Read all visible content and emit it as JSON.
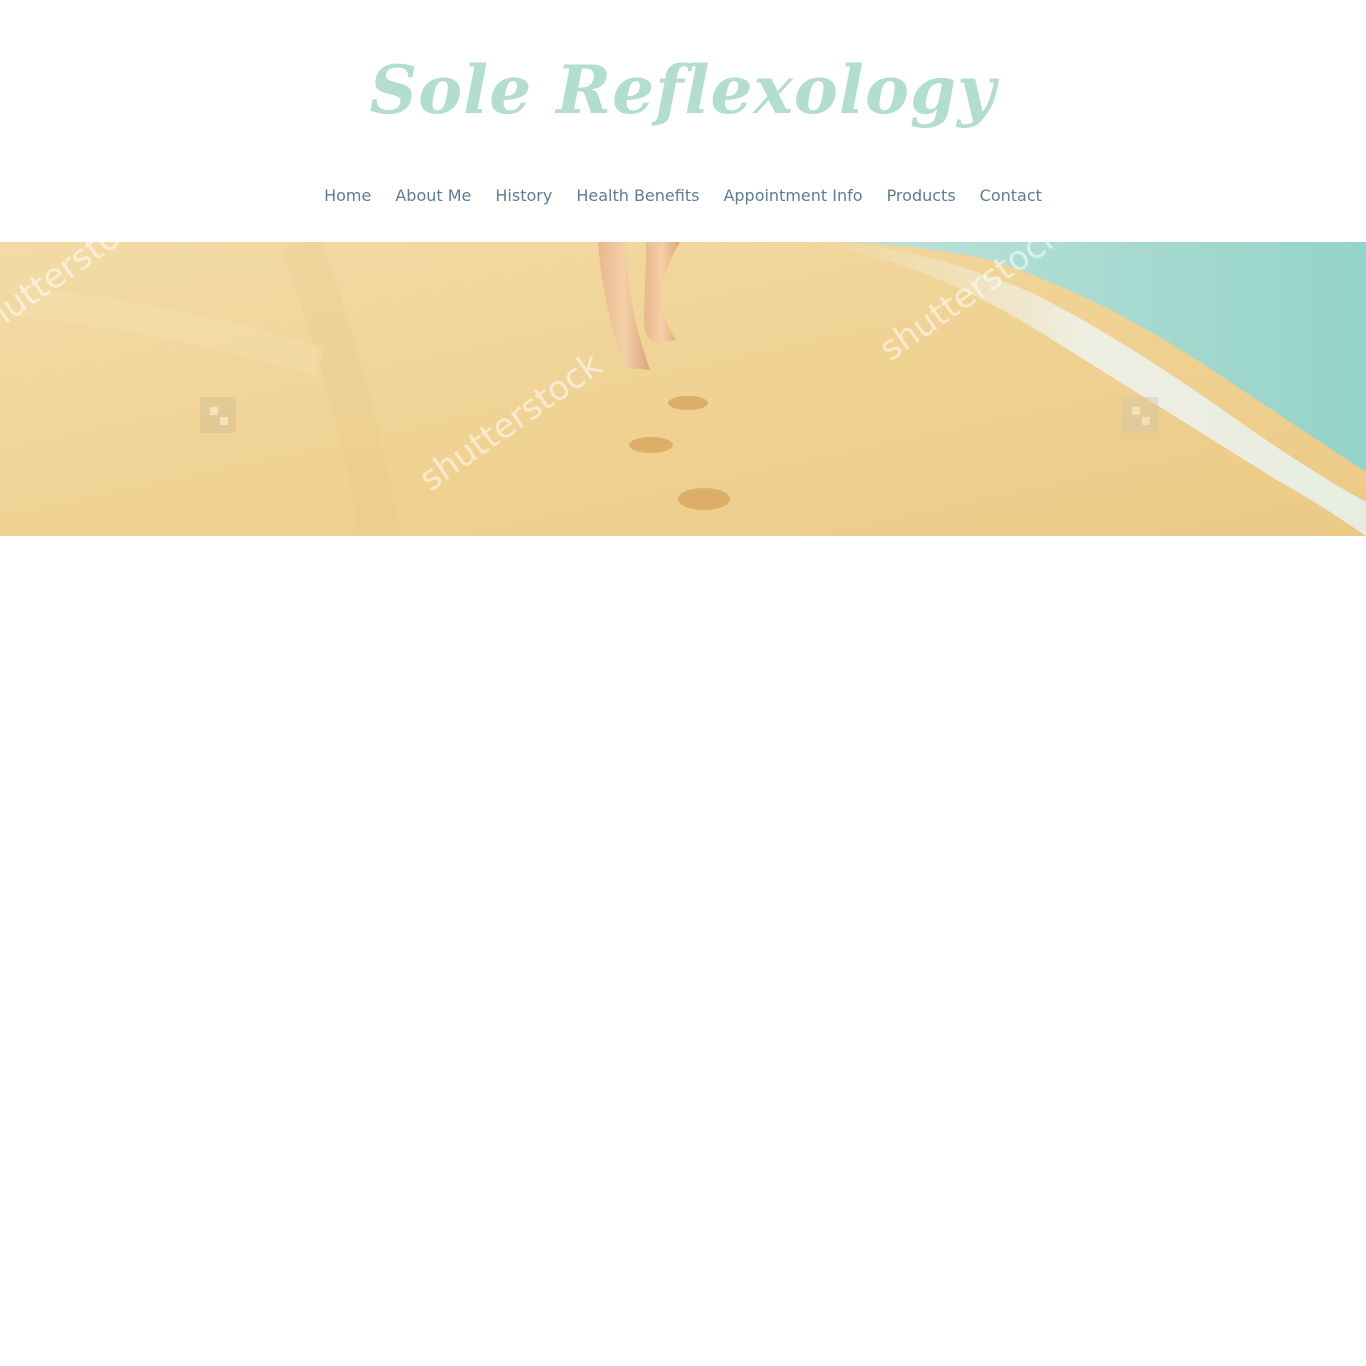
{
  "site": {
    "title": "Sole Reflexology"
  },
  "nav": {
    "items": [
      {
        "label": "Home"
      },
      {
        "label": "About Me"
      },
      {
        "label": "History"
      },
      {
        "label": "Health Benefits"
      },
      {
        "label": "Appointment Info"
      },
      {
        "label": "Products"
      },
      {
        "label": "Contact"
      }
    ]
  },
  "hero": {
    "watermark_text": "shutterstock",
    "icon": "beach-footprints-image"
  },
  "colors": {
    "logo": "#b3ddd1",
    "nav_text": "#5e7d8e",
    "sand": "#f0d49a",
    "sea": "#9fd6cc",
    "foam": "#eef0e6"
  }
}
